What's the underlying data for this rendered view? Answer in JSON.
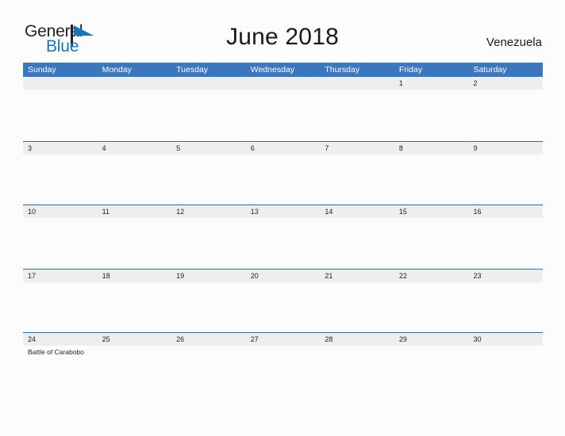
{
  "brand": {
    "name_part1": "General",
    "name_part2": "Blue",
    "color_dark": "#231f20",
    "color_blue": "#1b75bb"
  },
  "header": {
    "title": "June 2018",
    "country": "Venezuela"
  },
  "theme": {
    "header_blue": "#3c77be",
    "row_line_blue": "#2d6ca8",
    "day_band_gray": "#eeeeee",
    "page_background": "#fcfcfd"
  },
  "calendar": {
    "weekdays": [
      "Sunday",
      "Monday",
      "Tuesday",
      "Wednesday",
      "Thursday",
      "Friday",
      "Saturday"
    ],
    "weeks": [
      {
        "days": [
          {
            "num": "",
            "event": ""
          },
          {
            "num": "",
            "event": ""
          },
          {
            "num": "",
            "event": ""
          },
          {
            "num": "",
            "event": ""
          },
          {
            "num": "",
            "event": ""
          },
          {
            "num": "1",
            "event": ""
          },
          {
            "num": "2",
            "event": ""
          }
        ]
      },
      {
        "days": [
          {
            "num": "3",
            "event": ""
          },
          {
            "num": "4",
            "event": ""
          },
          {
            "num": "5",
            "event": ""
          },
          {
            "num": "6",
            "event": ""
          },
          {
            "num": "7",
            "event": ""
          },
          {
            "num": "8",
            "event": ""
          },
          {
            "num": "9",
            "event": ""
          }
        ]
      },
      {
        "days": [
          {
            "num": "10",
            "event": ""
          },
          {
            "num": "11",
            "event": ""
          },
          {
            "num": "12",
            "event": ""
          },
          {
            "num": "13",
            "event": ""
          },
          {
            "num": "14",
            "event": ""
          },
          {
            "num": "15",
            "event": ""
          },
          {
            "num": "16",
            "event": ""
          }
        ]
      },
      {
        "days": [
          {
            "num": "17",
            "event": ""
          },
          {
            "num": "18",
            "event": ""
          },
          {
            "num": "19",
            "event": ""
          },
          {
            "num": "20",
            "event": ""
          },
          {
            "num": "21",
            "event": ""
          },
          {
            "num": "22",
            "event": ""
          },
          {
            "num": "23",
            "event": ""
          }
        ]
      },
      {
        "days": [
          {
            "num": "24",
            "event": "Battle of Carabobo"
          },
          {
            "num": "25",
            "event": ""
          },
          {
            "num": "26",
            "event": ""
          },
          {
            "num": "27",
            "event": ""
          },
          {
            "num": "28",
            "event": ""
          },
          {
            "num": "29",
            "event": ""
          },
          {
            "num": "30",
            "event": ""
          }
        ]
      }
    ]
  }
}
